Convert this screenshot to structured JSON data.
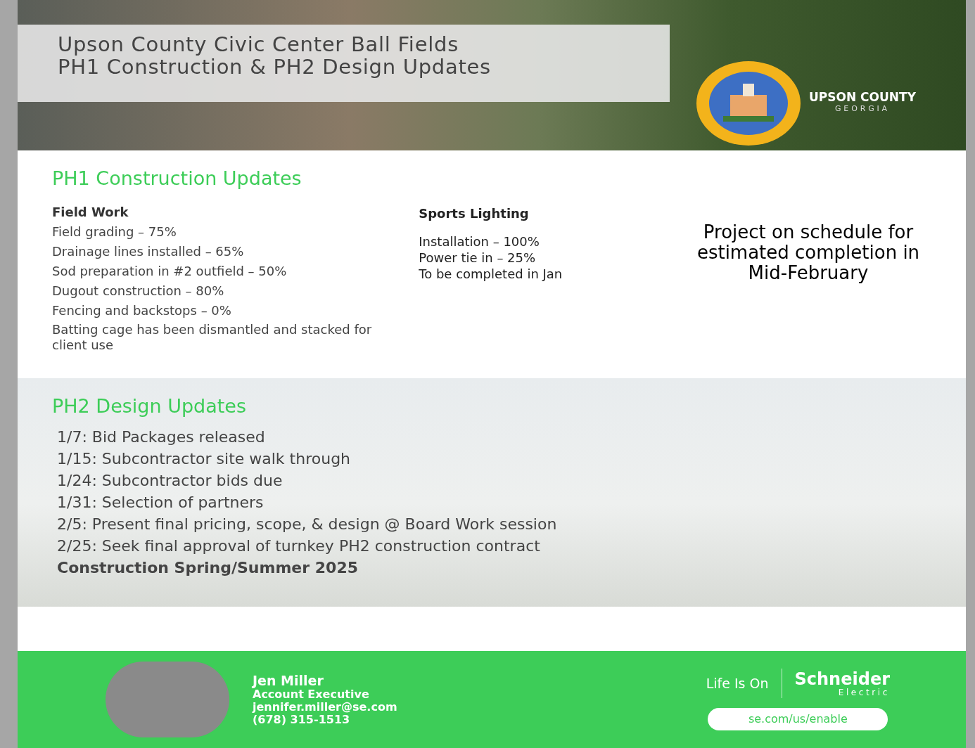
{
  "header": {
    "title_lines": [
      "Upson County Civic Center Ball Fields",
      "PH1 Construction & PH2 Design Updates"
    ],
    "wordmark": {
      "name": "UPSON COUNTY",
      "state": "GEORGIA"
    }
  },
  "ph1": {
    "heading": "PH1 Construction Updates",
    "field_work": {
      "title": "Field Work",
      "items": [
        "Field grading – 75%",
        "Drainage lines installed – 65%",
        "Sod preparation in #2 outfield – 50%",
        "Dugout construction – 80%",
        "Fencing and backstops – 0%",
        "Batting cage has been dismantled and stacked for client use"
      ]
    },
    "sports_lighting": {
      "title": "Sports Lighting",
      "items": [
        "Installation – 100%",
        "Power tie in – 25%",
        "To be completed in Jan"
      ]
    },
    "status_note": "Project on schedule for estimated completion in Mid-February"
  },
  "ph2": {
    "heading": "PH2 Design Updates",
    "items": [
      "1/7: Bid Packages released",
      "1/15: Subcontractor site walk through",
      "1/24: Subcontractor bids due",
      "1/31: Selection of partners",
      "2/5: Present final pricing, scope, & design @ Board Work session",
      "2/25: Seek final approval of turnkey PH2 construction contract"
    ],
    "closing": "Construction Spring/Summer 2025"
  },
  "footer": {
    "contact": {
      "name": "Jen Miller",
      "role": "Account Executive",
      "email": "jennifer.miller@se.com",
      "phone": "(678) 315-1513"
    },
    "tagline": "Life Is On",
    "brand": "Schneider",
    "brand_sub": "Electric",
    "link": "se.com/us/enable"
  }
}
